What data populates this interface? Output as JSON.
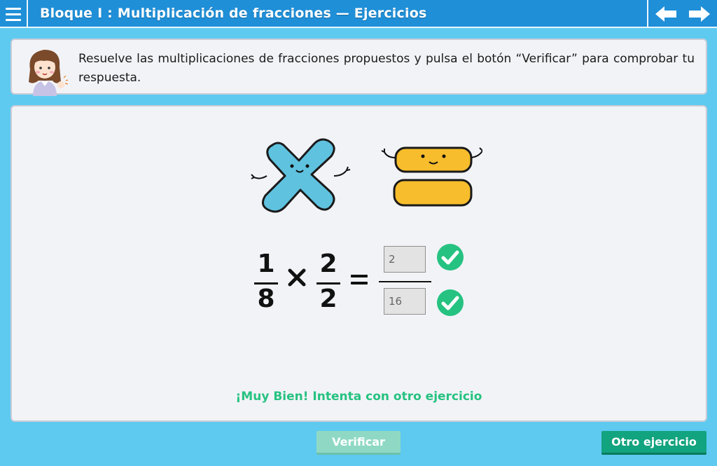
{
  "header": {
    "menu_icon": "hamburger-menu-icon",
    "title": "Bloque I : Multiplicación de fracciones  —  Ejercicios",
    "prev_icon": "arrow-left-icon",
    "next_icon": "arrow-right-icon",
    "background": "#1f8fd8"
  },
  "instruction": {
    "avatar_icon": "teacher-avatar-icon",
    "text": "Resuelve las multiplicaciones de fracciones propuestos y pulsa el botón “Verificar” para comprobar tu respuesta."
  },
  "exercise": {
    "mascot_icons": [
      "multiply-mascot-icon",
      "equals-mascot-icon"
    ],
    "fraction1": {
      "numerator": "1",
      "denominator": "8"
    },
    "operator_icon": "times-icon",
    "equals_icon": "equals-icon",
    "fraction2": {
      "numerator": "2",
      "denominator": "2"
    },
    "answer": {
      "numerator": "2",
      "denominator": "16"
    },
    "check_icons": [
      "check-circle-icon",
      "check-circle-icon"
    ],
    "feedback": "¡Muy Bien! Intenta con otro ejercicio"
  },
  "buttons": {
    "verify": "Verificar",
    "other": "Otro ejercicio"
  },
  "colors": {
    "page": "#5ecaf0",
    "success": "#26c281",
    "verify_disabled": "#8fd9c4",
    "other_button": "#12a37f"
  }
}
